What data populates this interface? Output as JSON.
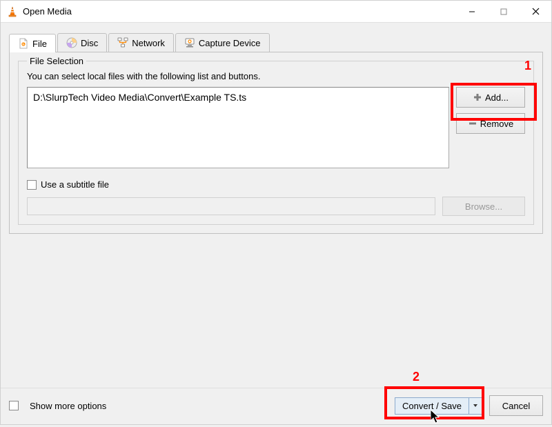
{
  "window": {
    "title": "Open Media"
  },
  "tabs": {
    "file": "File",
    "disc": "Disc",
    "network": "Network",
    "capture": "Capture Device"
  },
  "fileSelection": {
    "legend": "File Selection",
    "hint": "You can select local files with the following list and buttons.",
    "files": [
      "D:\\SlurpTech Video Media\\Convert\\Example TS.ts"
    ],
    "addLabel": "Add...",
    "removeLabel": "Remove"
  },
  "subtitle": {
    "checkboxLabel": "Use a subtitle file",
    "browseLabel": "Browse..."
  },
  "bottom": {
    "showMoreLabel": "Show more options",
    "convertSaveLabel": "Convert / Save",
    "cancelLabel": "Cancel"
  },
  "annotations": {
    "one": "1",
    "two": "2"
  }
}
